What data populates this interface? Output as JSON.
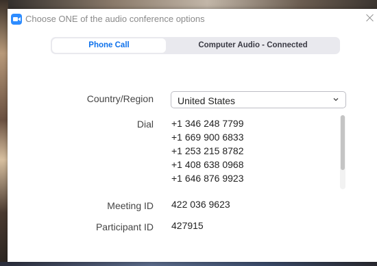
{
  "window": {
    "title": "Choose ONE of the audio conference options"
  },
  "tabs": [
    {
      "label": "Phone Call",
      "selected": true
    },
    {
      "label": "Computer Audio - Connected",
      "selected": false
    }
  ],
  "form": {
    "country_label": "Country/Region",
    "country_value": "United States",
    "dial_label": "Dial",
    "dial_numbers": [
      "+1 346 248 7799",
      "+1 669 900 6833",
      "+1 253 215 8782",
      "+1 408 638 0968",
      "+1 646 876 9923"
    ],
    "meeting_id_label": "Meeting ID",
    "meeting_id_value": "422 036 9623",
    "participant_id_label": "Participant ID",
    "participant_id_value": "427915"
  },
  "colors": {
    "accent": "#0e71eb",
    "app_icon": "#2d8cff"
  },
  "icons": {
    "app": "zoom-camera-icon",
    "close": "close-icon",
    "dropdown": "chevron-down-icon"
  }
}
